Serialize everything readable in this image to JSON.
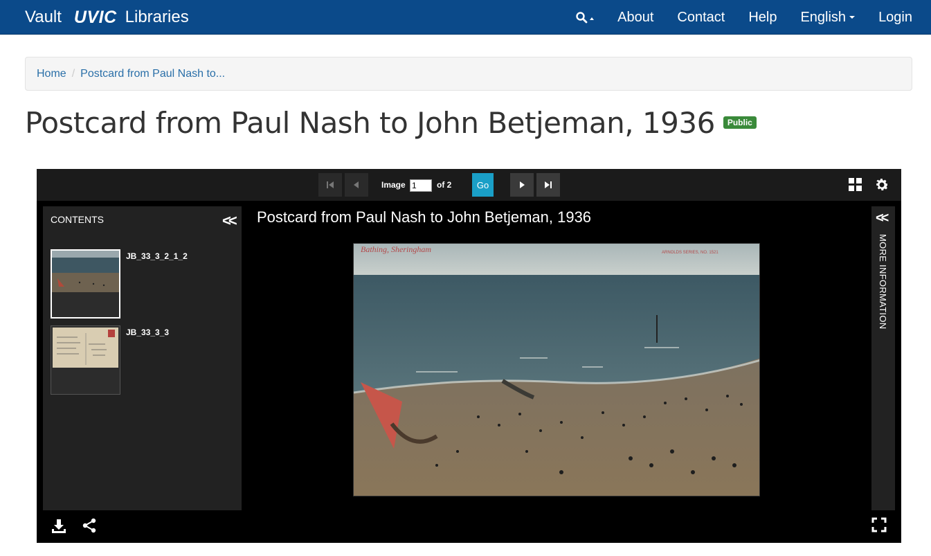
{
  "navbar": {
    "vault": "Vault",
    "uvic": "UVIC",
    "libraries": "Libraries",
    "about": "About",
    "contact": "Contact",
    "help": "Help",
    "language": "English",
    "login": "Login",
    "icons": {
      "search": "search-icon"
    }
  },
  "breadcrumb": {
    "home": "Home",
    "current": "Postcard from Paul Nash to..."
  },
  "page": {
    "title": "Postcard from Paul Nash to John Betjeman, 1936",
    "badge": "Public",
    "colors": {
      "navbar": "#0b4a8a",
      "badge": "#3a8a3a",
      "go": "#1a9fc7"
    }
  },
  "viewer": {
    "image_label": "Image",
    "page_value": "1",
    "of_total": "of 2",
    "go_label": "Go",
    "contents_title": "CONTENTS",
    "canvas_title": "Postcard from Paul Nash to John Betjeman, 1936",
    "more_info": "MORE INFORMATION",
    "items": [
      {
        "label": "JB_33_3_2_1_2"
      },
      {
        "label": "JB_33_3_3"
      }
    ],
    "postcard_caption": "Bathing, Sheringham",
    "postcard_series": "ARNOLDS SERIES, NO. 1521"
  }
}
